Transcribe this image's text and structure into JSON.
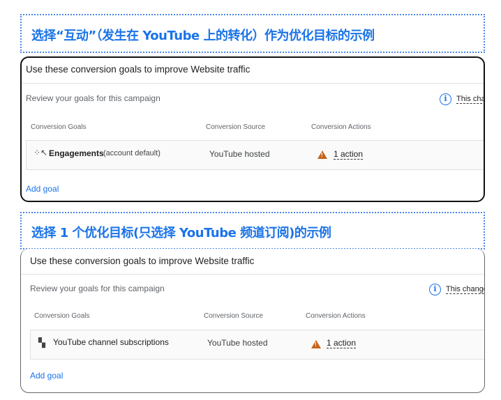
{
  "sections": [
    {
      "heading": "选择“互动”（发生在 YouTube 上的转化）作为优化目标的示例",
      "card": {
        "title": "Use these conversion goals to improve Website traffic",
        "review_text": "Review your goals for this campaign",
        "info_link": "This cha",
        "columns": [
          "Conversion Goals",
          "Conversion Source",
          "Conversion Actions"
        ],
        "row": {
          "goal_icon": "engagement-sparkle-icon",
          "goal": "Engagements",
          "goal_note": "(account default)",
          "source": "YouTube hosted",
          "actions": "1 action",
          "warning_icon": "warning-triangle-icon"
        },
        "add_goal": "Add goal"
      }
    },
    {
      "heading": "选择 1 个优化目标(只选择 YouTube 频道订阅)的示例",
      "card": {
        "title": "Use these conversion goals to improve Website traffic",
        "review_text": "Review your goals for this campaign",
        "info_link": "This change",
        "columns": [
          "Conversion Goals",
          "Conversion Source",
          "Conversion Actions"
        ],
        "row": {
          "goal_icon": "channel-subscription-grid-icon",
          "goal": "YouTube channel subscriptions",
          "source": "YouTube hosted",
          "actions": "1 action",
          "warning_icon": "warning-triangle-icon"
        },
        "add_goal": "Add goal"
      }
    }
  ],
  "colors": {
    "heading": "#1a73e8",
    "link": "#1a73e8",
    "warning": "#c5641a"
  }
}
